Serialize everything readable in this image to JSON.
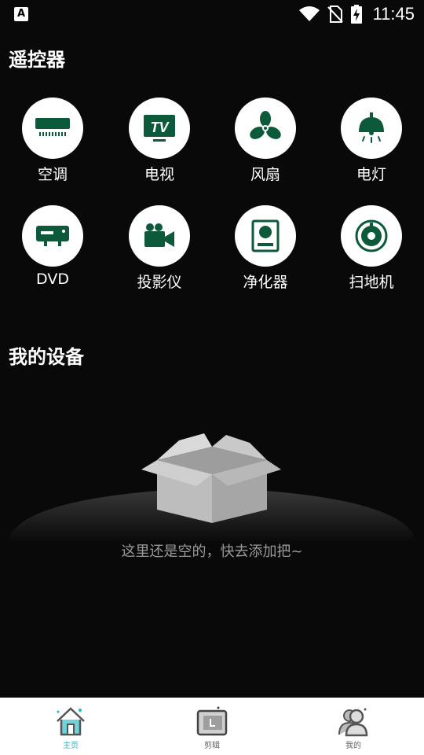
{
  "status_bar": {
    "app_icon_letter": "A",
    "time": "11:45",
    "icons": [
      "wifi-icon",
      "no-sim-icon",
      "battery-charging-icon"
    ]
  },
  "remote_section": {
    "title": "遥控器",
    "items": [
      {
        "label": "空调",
        "icon": "air-conditioner-icon"
      },
      {
        "label": "电视",
        "icon": "tv-icon"
      },
      {
        "label": "风扇",
        "icon": "fan-icon"
      },
      {
        "label": "电灯",
        "icon": "lamp-icon"
      },
      {
        "label": "DVD",
        "icon": "dvd-icon"
      },
      {
        "label": "投影仪",
        "icon": "projector-icon"
      },
      {
        "label": "净化器",
        "icon": "purifier-icon"
      },
      {
        "label": "扫地机",
        "icon": "robot-vacuum-icon"
      }
    ]
  },
  "devices_section": {
    "title": "我的设备",
    "empty_text": "这里还是空的，快去添加把~"
  },
  "bottom_nav": {
    "items": [
      {
        "label": "主页",
        "icon": "home-icon",
        "active": true
      },
      {
        "label": "剪辑",
        "icon": "edit-icon",
        "active": false
      },
      {
        "label": "我的",
        "icon": "user-icon",
        "active": false
      }
    ]
  },
  "colors": {
    "background": "#090909",
    "icon_green": "#0d5a3a",
    "accent": "#26b7c4"
  }
}
